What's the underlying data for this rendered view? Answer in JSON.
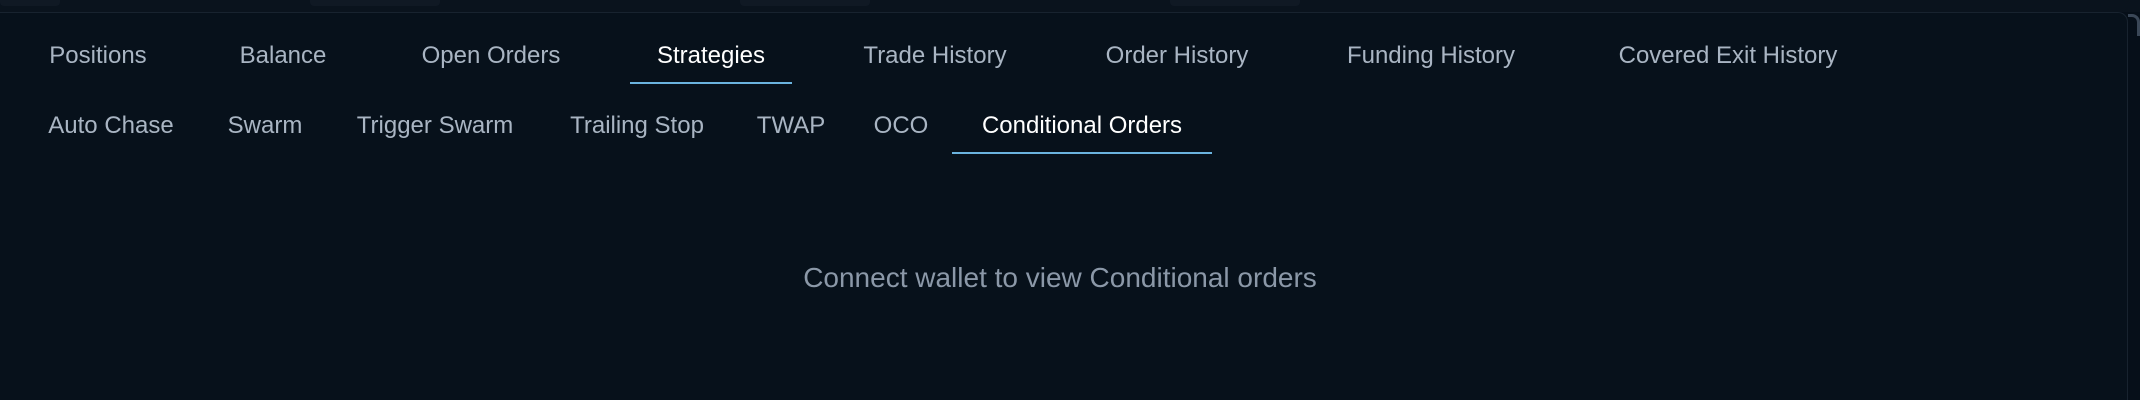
{
  "primary_tabs": [
    {
      "label": "Positions",
      "active": false
    },
    {
      "label": "Balance",
      "active": false
    },
    {
      "label": "Open Orders",
      "active": false
    },
    {
      "label": "Strategies",
      "active": true
    },
    {
      "label": "Trade History",
      "active": false
    },
    {
      "label": "Order History",
      "active": false
    },
    {
      "label": "Funding History",
      "active": false
    },
    {
      "label": "Covered Exit History",
      "active": false
    }
  ],
  "strategy_tabs": [
    {
      "label": "Auto Chase",
      "active": false
    },
    {
      "label": "Swarm",
      "active": false
    },
    {
      "label": "Trigger Swarm",
      "active": false
    },
    {
      "label": "Trailing Stop",
      "active": false
    },
    {
      "label": "TWAP",
      "active": false
    },
    {
      "label": "OCO",
      "active": false
    },
    {
      "label": "Conditional Orders",
      "active": true
    }
  ],
  "empty_state": {
    "message": "Connect wallet to view Conditional orders"
  },
  "colors": {
    "background": "#07111b",
    "active_underline": "#6ab3df",
    "active_text": "#ffffff",
    "inactive_text": "#a9b5c3",
    "muted_text": "#8b98a8"
  }
}
